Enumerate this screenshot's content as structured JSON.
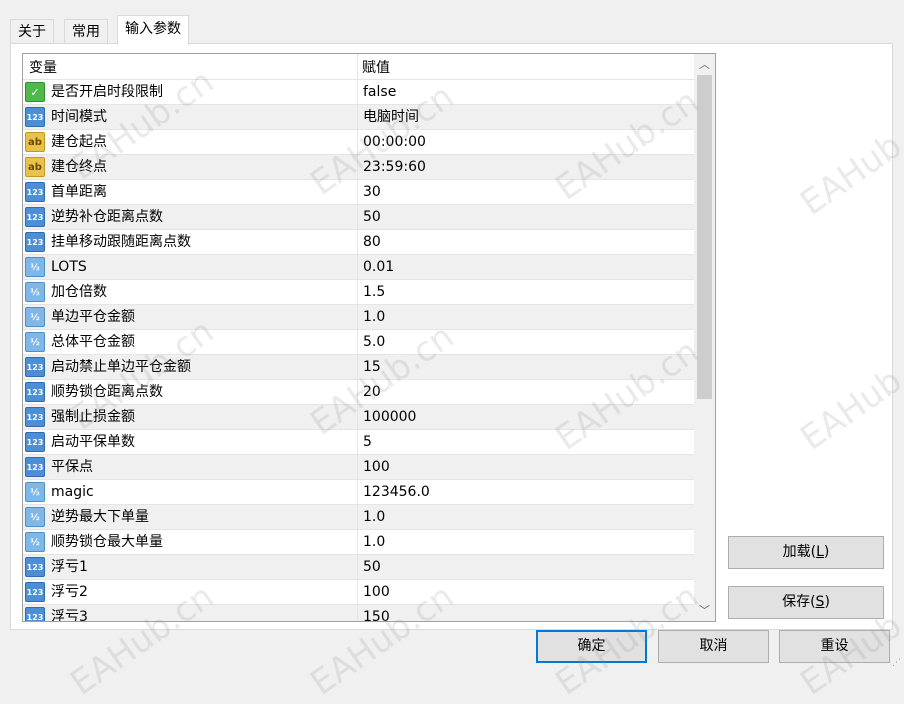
{
  "tabs": [
    {
      "label": "关于",
      "active": false
    },
    {
      "label": "常用",
      "active": false
    },
    {
      "label": "输入参数",
      "active": true
    }
  ],
  "grid": {
    "headers": {
      "variable": "变量",
      "value": "赋值"
    },
    "rows": [
      {
        "type": "bool",
        "icon": "boolean-type-icon",
        "name": "是否开启时段限制",
        "value": "false"
      },
      {
        "type": "int",
        "icon": "integer-type-icon",
        "name": "时间模式",
        "value": "电脑时间"
      },
      {
        "type": "str",
        "icon": "string-type-icon",
        "name": "建仓起点",
        "value": "00:00:00"
      },
      {
        "type": "str",
        "icon": "string-type-icon",
        "name": "建仓终点",
        "value": "23:59:60"
      },
      {
        "type": "int",
        "icon": "integer-type-icon",
        "name": "首单距离",
        "value": "30"
      },
      {
        "type": "int",
        "icon": "integer-type-icon",
        "name": "逆势补仓距离点数",
        "value": "50"
      },
      {
        "type": "int",
        "icon": "integer-type-icon",
        "name": "挂单移动跟随距离点数",
        "value": "80"
      },
      {
        "type": "dbl",
        "icon": "double-type-icon",
        "name": "LOTS",
        "value": "0.01"
      },
      {
        "type": "dbl",
        "icon": "double-type-icon",
        "name": "加仓倍数",
        "value": "1.5"
      },
      {
        "type": "dbl",
        "icon": "double-type-icon",
        "name": "单边平仓金额",
        "value": "1.0"
      },
      {
        "type": "dbl",
        "icon": "double-type-icon",
        "name": "总体平仓金额",
        "value": "5.0"
      },
      {
        "type": "int",
        "icon": "integer-type-icon",
        "name": "启动禁止单边平仓金额",
        "value": "15"
      },
      {
        "type": "int",
        "icon": "integer-type-icon",
        "name": "顺势锁仓距离点数",
        "value": "20"
      },
      {
        "type": "int",
        "icon": "integer-type-icon",
        "name": "强制止损金额",
        "value": "100000"
      },
      {
        "type": "int",
        "icon": "integer-type-icon",
        "name": "启动平保单数",
        "value": "5"
      },
      {
        "type": "int",
        "icon": "integer-type-icon",
        "name": "平保点",
        "value": "100"
      },
      {
        "type": "dbl",
        "icon": "double-type-icon",
        "name": "magic",
        "value": "123456.0"
      },
      {
        "type": "dbl",
        "icon": "double-type-icon",
        "name": "逆势最大下单量",
        "value": "1.0"
      },
      {
        "type": "dbl",
        "icon": "double-type-icon",
        "name": "顺势锁仓最大单量",
        "value": "1.0"
      },
      {
        "type": "int",
        "icon": "integer-type-icon",
        "name": "浮亏1",
        "value": "50"
      },
      {
        "type": "int",
        "icon": "integer-type-icon",
        "name": "浮亏2",
        "value": "100"
      },
      {
        "type": "int",
        "icon": "integer-type-icon",
        "name": "浮亏3",
        "value": "150"
      }
    ]
  },
  "type_icon_text": {
    "int": "123",
    "dbl": "½",
    "str": "ab",
    "bool": "✓"
  },
  "buttons": {
    "load": {
      "label": "加载(",
      "key": "L",
      "tail": ")"
    },
    "save": {
      "label": "保存(",
      "key": "S",
      "tail": ")"
    },
    "ok": "确定",
    "cancel": "取消",
    "reset": "重设"
  },
  "watermark_text": "EAHub.cn",
  "colors": {
    "focus_border": "#0078d7",
    "row_alt": "#f0f0f0"
  }
}
